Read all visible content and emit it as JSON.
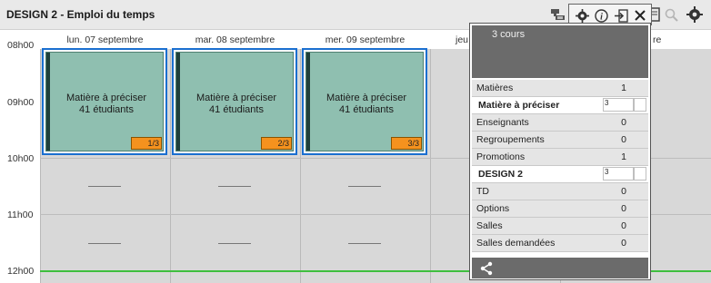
{
  "window": {
    "title": "DESIGN 2 - Emploi du temps"
  },
  "toolbar": {
    "icons": [
      "network-icon",
      "gear-icon",
      "info-icon",
      "export-icon",
      "close-icon",
      "print-icon",
      "search-icon",
      "settings-icon"
    ]
  },
  "days": [
    "lun. 07 septembre",
    "mar. 08 septembre",
    "mer. 09 septembre",
    "jeu",
    "re"
  ],
  "hours": [
    "08h00",
    "09h00",
    "10h00",
    "11h00",
    "12h00"
  ],
  "courses": [
    {
      "subject": "Matière à préciser",
      "students": "41 étudiants",
      "index": "1/3"
    },
    {
      "subject": "Matière à préciser",
      "students": "41 étudiants",
      "index": "2/3"
    },
    {
      "subject": "Matière à préciser",
      "students": "41 étudiants",
      "index": "3/3"
    }
  ],
  "panel": {
    "header": "3 cours",
    "rows": [
      {
        "label": "Matières",
        "value": "1"
      },
      {
        "label": "Matière à préciser",
        "value": "3"
      },
      {
        "label": "Enseignants",
        "value": "0"
      },
      {
        "label": "Regroupements",
        "value": "0"
      },
      {
        "label": "Promotions",
        "value": "1"
      },
      {
        "label": "DESIGN 2",
        "value": "3"
      },
      {
        "label": "TD",
        "value": "0"
      },
      {
        "label": "Options",
        "value": "0"
      },
      {
        "label": "Salles",
        "value": "0"
      },
      {
        "label": "Salles demandées",
        "value": "0"
      }
    ]
  },
  "colors": {
    "accent": "#1a6fd0",
    "card": "#8fbfb0",
    "badge": "#f5921e",
    "now_line": "#3fbf3f"
  }
}
